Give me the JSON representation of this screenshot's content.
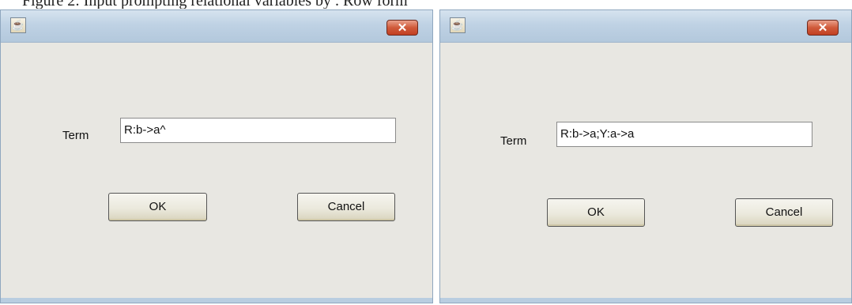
{
  "caption": "Figure 2: Input prompting relational variables by . Row form",
  "dialogs": [
    {
      "term_label": "Term",
      "term_value": "R:b->a^",
      "ok_label": "OK",
      "cancel_label": "Cancel",
      "close_glyph": "✕"
    },
    {
      "term_label": "Term",
      "term_value": "R:b->a;Y:a->a",
      "ok_label": "OK",
      "cancel_label": "Cancel",
      "close_glyph": "✕"
    }
  ],
  "icons": {
    "app_icon": "java-app-icon",
    "close_icon": "close-icon"
  },
  "colors": {
    "titlebar": "#bfd2e4",
    "close_button": "#c94a2d",
    "dialog_body": "#e8e7e2"
  }
}
